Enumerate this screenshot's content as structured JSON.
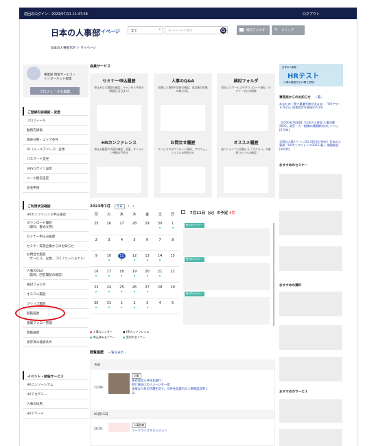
{
  "topbar": {
    "login_text": "前回のログイン：2023/07/11 11:47:58",
    "logout": "ログアウト"
  },
  "header": {
    "logo": "日本の人事部",
    "mypage": "マイページ",
    "select": "全て",
    "search_placeholder": "キーワードで探す",
    "btn_folder": "検討フォルダ",
    "btn_clip": "クリップ"
  },
  "breadcrumb": "日本の人事部TOP ＞ マイページ",
  "profile": {
    "name_line1": "事業部 情報サービス・",
    "name_line2": "インターネット関連",
    "edit": "プロフィールを編集"
  },
  "menu1": {
    "heading": "ご登録内容確認・変更",
    "items": [
      "プロフィール",
      "勤務先情報",
      "興味分野・エリア条件",
      "ID（メールアドレス）変更",
      "パスワード変更",
      "SNSログイン設定",
      "メール配信設定",
      "退会申請"
    ]
  },
  "menu2": {
    "heading": "ご利用状況確認",
    "items": [
      "HRカンファレンス申込確認",
      "ダウンロード履歴\n（資料、書式文例）",
      "セミナー申込み履歴",
      "セミナー実施企業からのお知らせ",
      "お問合せ履歴\n（サービス、企業、プロフェッショナル）",
      "人事のQ&A\n（質問、回答履歴の確認）",
      "検討フォルダ",
      "オススメ履歴",
      "クリップ履歴",
      "閲覧履歴",
      "連載フォロー管理",
      "閲覧履歴",
      "保存済み検索条件"
    ]
  },
  "menu3": {
    "heading": "イベント・勉強サービス",
    "items": [
      "HRコンソーシアム",
      "HRアカデミー",
      "人事の採用",
      "HRアワード"
    ]
  },
  "services": {
    "heading": "会員サービス",
    "cards": [
      {
        "title": "セミナー申込履歴",
        "desc": "申込みなど履歴の確認、キャンセル手続き（開催日当日まで）"
      },
      {
        "title": "人事のQ&A",
        "desc": "投稿した質問や回答の確認、承認後の投稿の取り消し"
      },
      {
        "title": "検討フォルダ",
        "desc": "保存したサービスやダウンロード資料、セミナーなどの情報"
      },
      {
        "title": "HRカンファレンス",
        "desc": "申込み履歴や内容の確認・変更、オンライン視聴の手続き"
      },
      {
        "title": "お問合せ履歴",
        "desc": "サービスやダウンロード資料、プロフェッショナルの問合わせ"
      },
      {
        "title": "オススメ履歴",
        "desc": "各コンテンツに投稿した「オススメ」や感想コメントの確認"
      }
    ]
  },
  "calendar": {
    "month": "2023年7月",
    "today_btn": "今日",
    "prev": "‹",
    "next": "›",
    "weekdays": [
      "月",
      "火",
      "水",
      "木",
      "金",
      "土",
      "日"
    ],
    "weeks": [
      [
        "25",
        "26",
        "27",
        "28",
        "29",
        "30",
        "1"
      ],
      [
        "2",
        "3",
        "4",
        "5",
        "6",
        "7",
        "8"
      ],
      [
        "9",
        "10",
        "11",
        "12",
        "13",
        "14",
        "15"
      ],
      [
        "16",
        "17",
        "18",
        "19",
        "20",
        "21",
        "22"
      ],
      [
        "23",
        "24",
        "25",
        "26",
        "27",
        "28",
        "29"
      ],
      [
        "30",
        "31",
        "1",
        "2",
        "3",
        "4",
        "5"
      ]
    ],
    "schedule_title": "7月11日（火）の予定",
    "schedule_count": "4件",
    "event_tag": "受付中セミナー",
    "legend": [
      "人事カレンダー",
      "HRカンファレンス",
      "申込済みセミナー",
      "受付中セミナー"
    ],
    "legend_colors": [
      "#e05050",
      "#15204a",
      "#3bb",
      "#4bb7a8"
    ]
  },
  "history": {
    "heading": "閲覧履歴",
    "link": "一覧を表示 ›",
    "today": "今日",
    "time1": "12:06",
    "badge1": "記事",
    "text1": "株式会社三井住友銀行：\n新行員向けのイメージを一新\n多様な人材の活躍を促す、三井住友銀行の人事制度改革と\nは",
    "date2": "02月15日",
    "time2": "20:01",
    "badge2": "人事辞典",
    "text2": "ワークライフマネジメント"
  },
  "right": {
    "banner_title": "HRテスト",
    "banner_sub": "人事の基礎力を10問で診断！",
    "banner_logo": "日本の人事部",
    "news_title": "事務局からのお知らせ",
    "news_link": "一覧 ›",
    "news": [
      "あなたの一票で最優秀賞が決まる！「HRアワード2023」投票受付を開始[07/10]",
      "【6500名が回答】「日本の人事部 人事白書2023」発売！人・組織の課題解決のヒントに[07/04]",
      "全国の人事パーソン23,332名が参加！日本の人事部「HRカンファレンス2023-春-」開催報告[06/09]"
    ],
    "seminar": "おすすめのセミナー",
    "docs": "おすすめの資料",
    "services": "おすすめのサービス"
  }
}
